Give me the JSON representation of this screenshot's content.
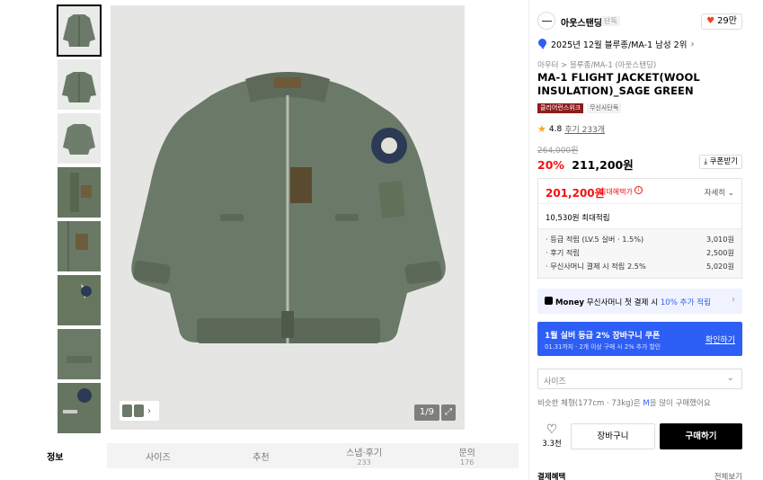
{
  "gallery": {
    "thumbnail_count": 8,
    "pager": "1/9",
    "expand_icon": "expand-icon",
    "mini_strip_arrow": "›"
  },
  "tabs": [
    {
      "label": "정보",
      "count": ""
    },
    {
      "label": "사이즈",
      "count": ""
    },
    {
      "label": "추천",
      "count": ""
    },
    {
      "label": "스냅·후기",
      "count": "233"
    },
    {
      "label": "문의",
      "count": "176"
    }
  ],
  "brand": {
    "name": "아웃스탠딩",
    "tag": "단독",
    "likes": "29만"
  },
  "rank": {
    "text": "2025년 12월 블루종/MA-1 남성 2위"
  },
  "breadcrumb": "아우터 > 블루종/MA-1 (아웃스탠딩)",
  "product": {
    "title": "MA-1 FLIGHT JACKET(WOOL INSULATION)_SAGE GREEN",
    "badges": [
      "클리어런스위크",
      "무신사단독"
    ]
  },
  "rating": {
    "score": "4.8",
    "reviews": "후기 233개"
  },
  "price": {
    "original": "264,000원",
    "discount": "20%",
    "sale": "211,200원",
    "coupon_label": "쿠폰받기"
  },
  "benefit": {
    "max_price": "201,200원",
    "max_label": "최대혜택가",
    "detail_label": "자세히",
    "points_label": "10,530원 최대적립",
    "rows": [
      {
        "label": "· 등급 적립 (LV.5 실버 · 1.5%)",
        "value": "3,010원"
      },
      {
        "label": "· 후기 적립",
        "value": "2,500원"
      },
      {
        "label": "· 무신사머니 결제 시 적립 2.5%",
        "value": "5,020원"
      }
    ]
  },
  "money_banner": {
    "brand": "Money",
    "text": "무신사머니 첫 결제 시",
    "highlight": "10% 추가 적립"
  },
  "blue_coupon": {
    "title": "1월 실버 등급 2% 장바구니 쿠폰",
    "sub": "01.31까지 · 2개 이상 구매 시 2% 추가 할인",
    "button": "확인하기"
  },
  "size_select": {
    "placeholder": "사이즈"
  },
  "fit_text": {
    "prefix": "비슷한 체형(177cm · 73kg)은 ",
    "size": "M",
    "suffix": "을 많이 구매했어요"
  },
  "actions": {
    "like_count": "3.3천",
    "cart": "장바구니",
    "buy": "구매하기"
  },
  "payment": {
    "label": "결제혜택",
    "all": "전체보기"
  },
  "colors": {
    "accent_red": "#f31110",
    "accent_blue": "#2d5ef5",
    "jacket": "#6b7a68"
  }
}
